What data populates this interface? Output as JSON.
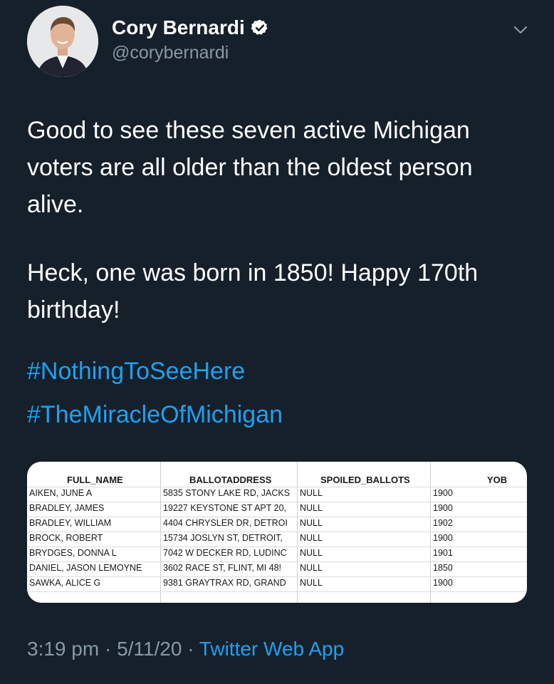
{
  "author": {
    "display_name": "Cory Bernardi",
    "handle": "@corybernardi",
    "verified_icon": "verified-badge-icon"
  },
  "tweet": {
    "paragraphs": [
      "Good to see these seven active Michigan voters are all older than the oldest person alive.",
      "Heck, one was born in 1850! Happy 170th birthday!"
    ],
    "hashtags": [
      "#NothingToSeeHere",
      "#TheMiracleOfMichigan"
    ]
  },
  "table": {
    "headers": {
      "name": "FULL_NAME",
      "address": "BALLOTADDRESS",
      "spoiled": "SPOILED_BALLOTS",
      "yob": "YOB"
    },
    "rows": [
      {
        "name": "AIKEN, JUNE A",
        "address": "5835 STONY LAKE RD, JACKS",
        "spoiled": "NULL",
        "yob": "1900"
      },
      {
        "name": "BRADLEY, JAMES",
        "address": "19227 KEYSTONE ST APT 20,",
        "spoiled": "NULL",
        "yob": "1900"
      },
      {
        "name": "BRADLEY, WILLIAM",
        "address": "4404 CHRYSLER DR, DETROI",
        "spoiled": "NULL",
        "yob": "1902"
      },
      {
        "name": "BROCK, ROBERT",
        "address": "15734 JOSLYN ST, DETROIT,",
        "spoiled": "NULL",
        "yob": "1900"
      },
      {
        "name": "BRYDGES, DONNA L",
        "address": "7042 W DECKER RD, LUDINC",
        "spoiled": "NULL",
        "yob": "1901"
      },
      {
        "name": "DANIEL, JASON LEMOYNE",
        "address": "3602 RACE ST, FLINT, MI 48!",
        "spoiled": "NULL",
        "yob": "1850"
      },
      {
        "name": "SAWKA, ALICE G",
        "address": "9381 GRAYTRAX RD, GRAND",
        "spoiled": "NULL",
        "yob": "1900"
      }
    ]
  },
  "footer": {
    "time": "3:19 pm",
    "date": "5/11/20",
    "separator": "·",
    "source": "Twitter Web App"
  },
  "colors": {
    "background": "#15202b",
    "text": "#ffffff",
    "secondary": "#8899a6",
    "accent": "#1da1f2"
  }
}
